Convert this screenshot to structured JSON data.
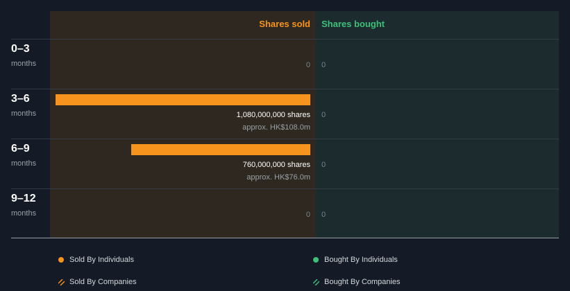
{
  "colors": {
    "sold": "#f7941d",
    "bought": "#3ec07a",
    "sold_bg": "#2e2820",
    "bought_bg": "#1b2b2e",
    "page_bg": "#151b26"
  },
  "columns": {
    "sold": "Shares sold",
    "bought": "Shares bought"
  },
  "legend": {
    "sold_individuals": "Sold By Individuals",
    "bought_individuals": "Bought By Individuals",
    "sold_companies": "Sold By Companies",
    "bought_companies": "Bought By Companies"
  },
  "chart_data": {
    "type": "bar",
    "categories": [
      "0–3 months",
      "3–6 months",
      "6–9 months",
      "9–12 months"
    ],
    "series": [
      {
        "name": "Shares sold",
        "values": [
          0,
          1080000000,
          760000000,
          0
        ]
      },
      {
        "name": "Shares bought",
        "values": [
          0,
          0,
          0,
          0
        ]
      }
    ],
    "rows": [
      {
        "range": "0–3",
        "unit": "months",
        "sold": 0,
        "sold_label": "0",
        "sold_approx": "",
        "bought_label": "0"
      },
      {
        "range": "3–6",
        "unit": "months",
        "sold": 1080000000,
        "sold_label": "1,080,000,000 shares",
        "sold_approx": "approx. HK$108.0m",
        "bought_label": "0"
      },
      {
        "range": "6–9",
        "unit": "months",
        "sold": 760000000,
        "sold_label": "760,000,000 shares",
        "sold_approx": "approx. HK$76.0m",
        "bought_label": "0"
      },
      {
        "range": "9–12",
        "unit": "months",
        "sold": 0,
        "sold_label": "0",
        "sold_approx": "",
        "bought_label": "0"
      }
    ]
  }
}
